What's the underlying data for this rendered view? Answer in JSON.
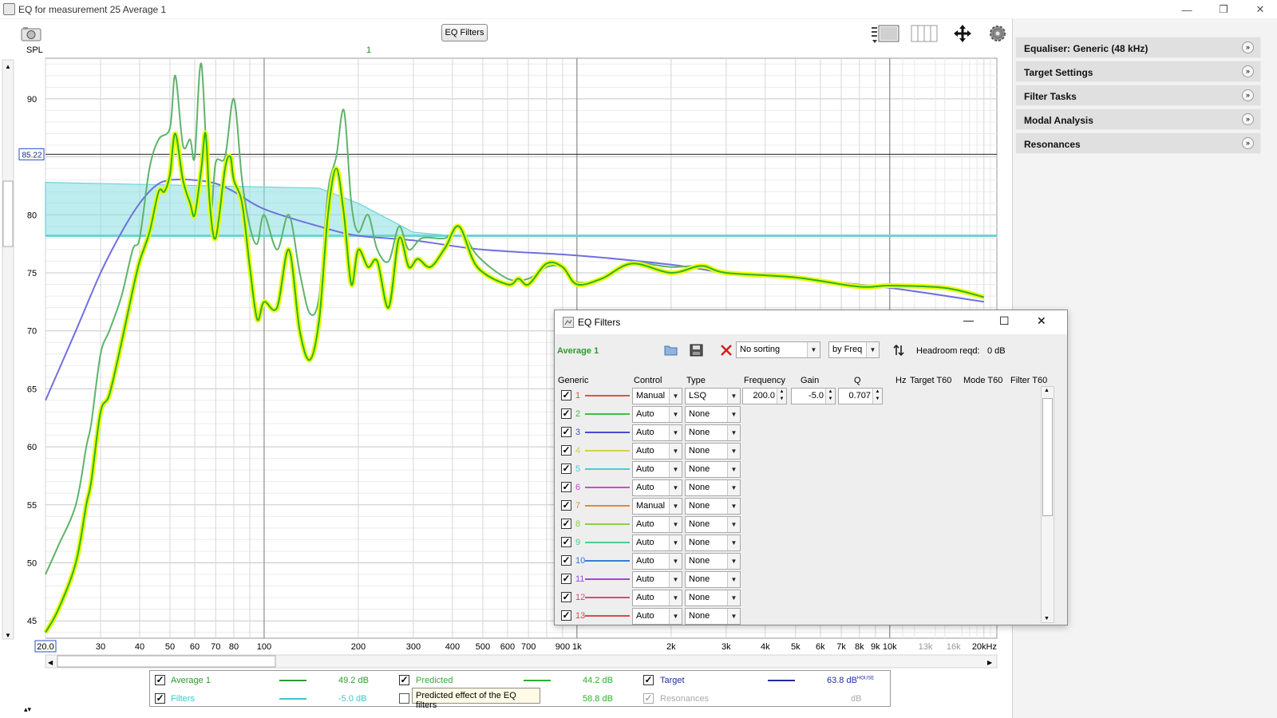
{
  "window": {
    "title": "EQ for measurement 25 Average 1",
    "controls": {
      "minimize": "—",
      "restore": "❐",
      "close": "✕"
    }
  },
  "toolbar": {
    "eq_filters_button": "EQ Filters",
    "icons": [
      "camera-icon",
      "legend-toggle-icon",
      "columns-icon",
      "pan-arrows-icon",
      "gear-icon"
    ]
  },
  "graph": {
    "y_axis_title": "SPL",
    "top_marker": "1",
    "cursor_value": "85.22",
    "x_cursor_value": "20.0",
    "x_unit_suffix": "kHz",
    "colors": {
      "measurement": "#5fb36b",
      "predicted": "#2fb02f",
      "predicted_halo": "#e7ff00",
      "target": "#6f6fe0",
      "target_band_fill": "#86dfe0",
      "target_band_edge": "#6fd3d6"
    }
  },
  "chart_data": {
    "type": "line",
    "title": "",
    "xlabel": "",
    "ylabel": "SPL",
    "xscale": "log",
    "xlim": [
      20,
      22000
    ],
    "ylim": [
      43.5,
      93.5
    ],
    "grid": true,
    "y_ticks": [
      45,
      50,
      55,
      60,
      65,
      70,
      75,
      80,
      85,
      90
    ],
    "x_ticks": [
      {
        "v": 20,
        "label": "20.0"
      },
      {
        "v": 30,
        "label": "30"
      },
      {
        "v": 40,
        "label": "40"
      },
      {
        "v": 50,
        "label": "50"
      },
      {
        "v": 60,
        "label": "60"
      },
      {
        "v": 70,
        "label": "70"
      },
      {
        "v": 80,
        "label": "80"
      },
      {
        "v": 100,
        "label": "100"
      },
      {
        "v": 200,
        "label": "200"
      },
      {
        "v": 300,
        "label": "300"
      },
      {
        "v": 400,
        "label": "400"
      },
      {
        "v": 500,
        "label": "500"
      },
      {
        "v": 600,
        "label": "600"
      },
      {
        "v": 700,
        "label": "700"
      },
      {
        "v": 900,
        "label": "900"
      },
      {
        "v": 1000,
        "label": "1k"
      },
      {
        "v": 2000,
        "label": "2k"
      },
      {
        "v": 3000,
        "label": "3k"
      },
      {
        "v": 4000,
        "label": "4k"
      },
      {
        "v": 5000,
        "label": "5k"
      },
      {
        "v": 6000,
        "label": "6k"
      },
      {
        "v": 7000,
        "label": "7k"
      },
      {
        "v": 8000,
        "label": "8k"
      },
      {
        "v": 9000,
        "label": "9k"
      },
      {
        "v": 10000,
        "label": "10k"
      },
      {
        "v": 13000,
        "label": "13k"
      },
      {
        "v": 16000,
        "label": "16k"
      },
      {
        "v": 20000,
        "label": "20kHz"
      }
    ],
    "horizontal_cursor": 85.22,
    "vertical_markers": [
      100,
      1000,
      10000
    ],
    "target_band": {
      "low": 78.2,
      "high_points": [
        [
          20,
          82.8
        ],
        [
          150,
          82.3
        ],
        [
          200,
          81
        ],
        [
          300,
          78.5
        ],
        [
          400,
          78.2
        ],
        [
          22000,
          78.2
        ]
      ]
    },
    "series": [
      {
        "name": "Target",
        "points": [
          [
            20,
            64
          ],
          [
            25,
            70
          ],
          [
            30,
            75
          ],
          [
            35,
            78.5
          ],
          [
            40,
            81
          ],
          [
            45,
            82.5
          ],
          [
            50,
            83
          ],
          [
            60,
            83
          ],
          [
            70,
            82.7
          ],
          [
            80,
            82
          ],
          [
            100,
            80.5
          ],
          [
            150,
            79
          ],
          [
            200,
            78.2
          ],
          [
            300,
            77.8
          ],
          [
            500,
            77
          ],
          [
            1000,
            76.5
          ],
          [
            2000,
            75.7
          ],
          [
            3000,
            75
          ],
          [
            5000,
            74.5
          ],
          [
            10000,
            73.7
          ],
          [
            20000,
            72.5
          ]
        ]
      },
      {
        "name": "Average 1",
        "points": [
          [
            20,
            49
          ],
          [
            22,
            51.5
          ],
          [
            25,
            55
          ],
          [
            27,
            60
          ],
          [
            28,
            62
          ],
          [
            30,
            68
          ],
          [
            32,
            70
          ],
          [
            35,
            73
          ],
          [
            38,
            77
          ],
          [
            40,
            78
          ],
          [
            43,
            84
          ],
          [
            46,
            86.5
          ],
          [
            50,
            87.5
          ],
          [
            52,
            92
          ],
          [
            55,
            86
          ],
          [
            58,
            86.5
          ],
          [
            60,
            85
          ],
          [
            63,
            93
          ],
          [
            67,
            80
          ],
          [
            70,
            84.5
          ],
          [
            75,
            85
          ],
          [
            80,
            90
          ],
          [
            85,
            83
          ],
          [
            90,
            79
          ],
          [
            95,
            77.5
          ],
          [
            100,
            80
          ],
          [
            110,
            77
          ],
          [
            120,
            80
          ],
          [
            130,
            75
          ],
          [
            140,
            71.5
          ],
          [
            150,
            73
          ],
          [
            160,
            82
          ],
          [
            170,
            85
          ],
          [
            180,
            89
          ],
          [
            190,
            81
          ],
          [
            200,
            78.5
          ],
          [
            215,
            80
          ],
          [
            230,
            77
          ],
          [
            250,
            76
          ],
          [
            270,
            79
          ],
          [
            290,
            77
          ],
          [
            320,
            78
          ],
          [
            380,
            78
          ],
          [
            420,
            79
          ],
          [
            480,
            76.5
          ],
          [
            600,
            74.5
          ],
          [
            700,
            74.5
          ],
          [
            800,
            75.5
          ],
          [
            900,
            75.5
          ],
          [
            1000,
            74.2
          ],
          [
            1200,
            74.5
          ],
          [
            1500,
            75.8
          ],
          [
            2000,
            75.5
          ],
          [
            2500,
            75.6
          ],
          [
            3000,
            75
          ],
          [
            5000,
            74.6
          ],
          [
            8000,
            73.8
          ],
          [
            10000,
            73.9
          ],
          [
            15000,
            73.6
          ],
          [
            20000,
            73
          ]
        ]
      },
      {
        "name": "Predicted",
        "points": [
          [
            20,
            44
          ],
          [
            22,
            46
          ],
          [
            25,
            50
          ],
          [
            27,
            55
          ],
          [
            28,
            57
          ],
          [
            30,
            63
          ],
          [
            32,
            64.5
          ],
          [
            35,
            69
          ],
          [
            38,
            73.5
          ],
          [
            40,
            76
          ],
          [
            43,
            78.5
          ],
          [
            46,
            82
          ],
          [
            48,
            82
          ],
          [
            50,
            83.5
          ],
          [
            52,
            87
          ],
          [
            55,
            83
          ],
          [
            58,
            81
          ],
          [
            60,
            80
          ],
          [
            63,
            84
          ],
          [
            65,
            87
          ],
          [
            67,
            81
          ],
          [
            70,
            78
          ],
          [
            75,
            84
          ],
          [
            78,
            85
          ],
          [
            80,
            83
          ],
          [
            85,
            81
          ],
          [
            90,
            75.5
          ],
          [
            95,
            71
          ],
          [
            100,
            72.5
          ],
          [
            110,
            72
          ],
          [
            120,
            77
          ],
          [
            130,
            70
          ],
          [
            140,
            67.5
          ],
          [
            150,
            71
          ],
          [
            160,
            80
          ],
          [
            170,
            84
          ],
          [
            180,
            80
          ],
          [
            190,
            74
          ],
          [
            200,
            77
          ],
          [
            215,
            75.5
          ],
          [
            230,
            76
          ],
          [
            250,
            72
          ],
          [
            270,
            78
          ],
          [
            290,
            75.5
          ],
          [
            310,
            76.2
          ],
          [
            340,
            75.5
          ],
          [
            380,
            77.2
          ],
          [
            420,
            79
          ],
          [
            480,
            75.5
          ],
          [
            600,
            74
          ],
          [
            650,
            74.5
          ],
          [
            700,
            74
          ],
          [
            800,
            75.8
          ],
          [
            900,
            75.5
          ],
          [
            1000,
            74
          ],
          [
            1200,
            74.5
          ],
          [
            1500,
            75.8
          ],
          [
            2000,
            75
          ],
          [
            2500,
            75.6
          ],
          [
            3000,
            75
          ],
          [
            5000,
            74.6
          ],
          [
            8000,
            73.8
          ],
          [
            10000,
            73.9
          ],
          [
            15000,
            73.7
          ],
          [
            20000,
            72.9
          ]
        ]
      }
    ]
  },
  "right_panel": {
    "sections": [
      "Equaliser: Generic (48 kHz)",
      "Target Settings",
      "Filter Tasks",
      "Modal Analysis",
      "Resonances"
    ],
    "chevron": "»"
  },
  "eq_dialog": {
    "title": "EQ Filters",
    "controls": {
      "minimize": "—",
      "maximize": "☐",
      "close": "✕"
    },
    "measurement": "Average 1",
    "sorting": "No sorting",
    "sort_key": "by Freq",
    "headroom_label": "Headroom reqd:",
    "headroom_value": "0 dB",
    "headers": {
      "generic": "Generic",
      "control": "Control",
      "type": "Type",
      "frequency": "Frequency",
      "gain": "Gain",
      "q": "Q",
      "hz": "Hz",
      "target_t60": "Target T60",
      "mode_t60": "Mode T60",
      "filter_t60": "Filter T60"
    },
    "filters": [
      {
        "num": "1",
        "color": "#e05050",
        "control": "Manual",
        "type": "LSQ",
        "frequency": "200.0",
        "gain": "-5.0",
        "q": "0.707"
      },
      {
        "num": "2",
        "color": "#3fbf3f",
        "control": "Auto",
        "type": "None"
      },
      {
        "num": "3",
        "color": "#4a4acf",
        "control": "Auto",
        "type": "None"
      },
      {
        "num": "4",
        "color": "#d8d04a",
        "control": "Auto",
        "type": "None"
      },
      {
        "num": "5",
        "color": "#4acdcf",
        "control": "Auto",
        "type": "None"
      },
      {
        "num": "6",
        "color": "#d04ad0",
        "control": "Auto",
        "type": "None"
      },
      {
        "num": "7",
        "color": "#e08a3a",
        "control": "Manual",
        "type": "None"
      },
      {
        "num": "8",
        "color": "#8acf4a",
        "control": "Auto",
        "type": "None"
      },
      {
        "num": "9",
        "color": "#4acf8a",
        "control": "Auto",
        "type": "None"
      },
      {
        "num": "10",
        "color": "#3a7ad8",
        "control": "Auto",
        "type": "None"
      },
      {
        "num": "11",
        "color": "#9a4ad8",
        "control": "Auto",
        "type": "None"
      },
      {
        "num": "12",
        "color": "#d84a7a",
        "control": "Auto",
        "type": "None"
      },
      {
        "num": "13",
        "color": "#d84a4a",
        "control": "Auto",
        "type": "None"
      }
    ]
  },
  "legend": {
    "items": [
      {
        "label": "Average 1",
        "value": "49.2 dB",
        "color": "#2e9a2e",
        "checked": true
      },
      {
        "label": "Predicted",
        "value": "44.2 dB",
        "color": "#2fb02f",
        "checked": true
      },
      {
        "label": "Target",
        "value": "63.8 dB",
        "superscript": "HOUSE",
        "color": "#1f2fa0",
        "checked": true
      },
      {
        "label": "Filters",
        "value": "-5.0 dB",
        "color": "#3fc6c6",
        "checked": true
      },
      {
        "label": "",
        "value": "58.8 dB",
        "checked": false
      },
      {
        "label": "Resonances",
        "value": "dB",
        "checked": true,
        "disabled": true
      }
    ],
    "tooltip": "Predicted effect of the EQ filters"
  }
}
